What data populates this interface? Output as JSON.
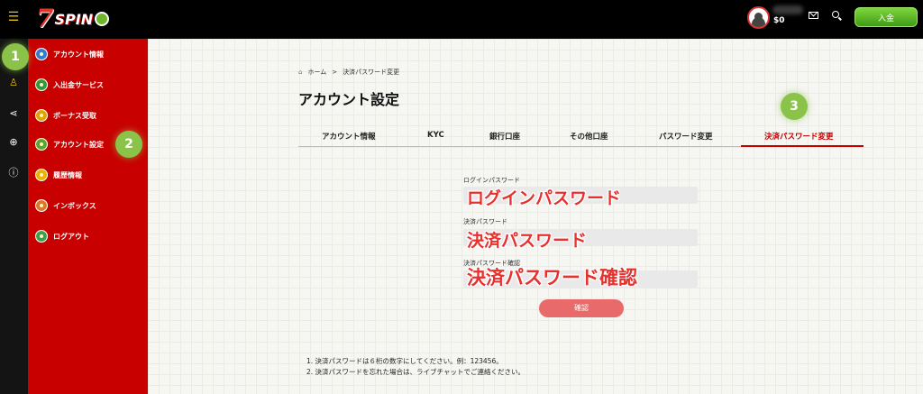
{
  "header": {
    "logo_seven": "7",
    "logo_text": "SPIN",
    "balance": "$0",
    "deposit_label": "入金"
  },
  "rail_icons": [
    "menu-icon",
    "user-icon",
    "share-icon",
    "globe-icon",
    "info-icon"
  ],
  "sidebar": {
    "items": [
      {
        "label": "アカウント情報",
        "icon": "account-info-icon",
        "color": "#2e7dd1"
      },
      {
        "label": "入出金サービス",
        "icon": "deposit-service-icon",
        "color": "#2e9a3b"
      },
      {
        "label": "ボーナス受取",
        "icon": "bonus-icon",
        "color": "#e0a400"
      },
      {
        "label": "アカウント設定",
        "icon": "account-settings-icon",
        "color": "#58a72c"
      },
      {
        "label": "履歴情報",
        "icon": "history-icon",
        "color": "#e8b400"
      },
      {
        "label": "インボックス",
        "icon": "inbox-icon",
        "color": "#d9792a"
      },
      {
        "label": "ログアウト",
        "icon": "logout-icon",
        "color": "#3aa14a"
      }
    ]
  },
  "badges": [
    "1",
    "2",
    "3"
  ],
  "breadcrumb": {
    "home": "ホーム",
    "separator": ">",
    "current": "決済パスワード変更"
  },
  "page_title": "アカウント設定",
  "tabs": [
    "アカウント情報",
    "KYC",
    "銀行口座",
    "その他口座",
    "パスワード変更",
    "決済パスワード変更"
  ],
  "form": {
    "login_password_label": "ログインパスワード",
    "login_password_overlay": "ログインパスワード",
    "payment_password_label": "決済パスワード",
    "payment_password_overlay": "決済パスワード",
    "payment_password_confirm_label": "決済パスワード確認",
    "payment_password_confirm_overlay": "決済パスワード確認",
    "confirm_button": "確認"
  },
  "notes": [
    "1. 決済パスワードは６桁の数字にしてください。例：123456。",
    "2. 決済パスワードを忘れた場合は、ライブチャットでご連絡ください。"
  ],
  "colors": {
    "sidebar_red": "#c80000",
    "accent_green": "#8bc34a",
    "deposit_green": "#4caf1f",
    "confirm_button": "#e86a6a"
  }
}
